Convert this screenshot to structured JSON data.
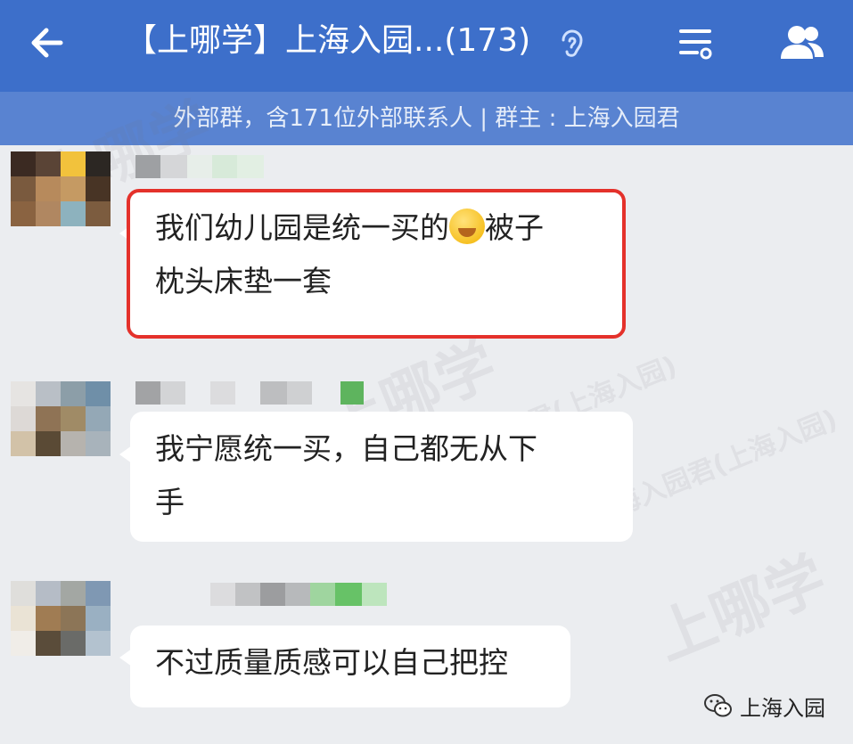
{
  "header": {
    "title": "【上哪学】上海入园...(173)",
    "back_icon": "back-arrow-icon",
    "ear_icon": "ear-icon",
    "settings_icon": "settings-icon",
    "members_icon": "members-icon",
    "color": "#3d6fca"
  },
  "subheader": {
    "text": "外部群，含171位外部联系人 | 群主 : 上海入园君",
    "color": "#5983d1"
  },
  "messages": [
    {
      "text_line1": "我们幼儿园是统一买的",
      "emoji": "weary-face-emoji",
      "text_line1b": "被子",
      "text_line2": "枕头床垫一套",
      "highlighted": true
    },
    {
      "text_line1": "我宁愿统一买，自己都无从下",
      "text_line2": "手",
      "highlighted": false
    },
    {
      "text_line1": "不过质量质感可以自己把控",
      "highlighted": false
    }
  ],
  "watermarks": {
    "brand": "上哪学",
    "caption": "上海入园君(上海入园)"
  },
  "footer": {
    "brand": "上海入园",
    "icon": "wechat-icon"
  },
  "highlight_color": "#e4312b"
}
